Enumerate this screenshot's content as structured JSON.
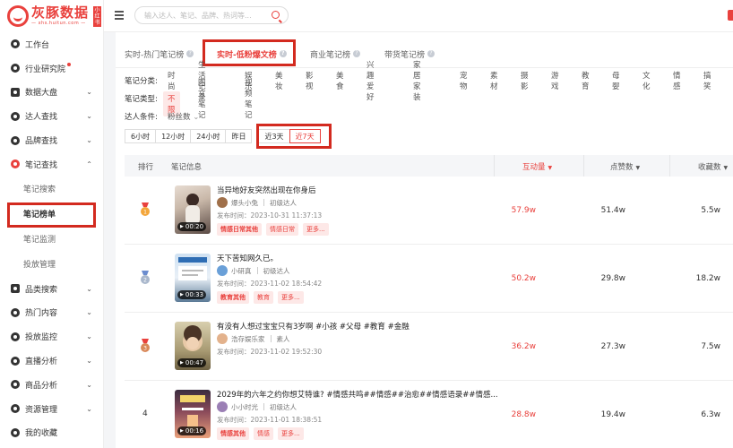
{
  "app": {
    "logo_name": "灰豚数据",
    "logo_sub": "— xhs.huitun.com —",
    "logo_badge": "小红书",
    "brand_color": "#e9413d"
  },
  "search": {
    "placeholder": "输入达人、笔记、品牌、热词等...",
    "value": ""
  },
  "sidebar": {
    "items": [
      {
        "label": "工作台",
        "icon": "home-icon"
      },
      {
        "label": "行业研究院",
        "icon": "research-icon"
      },
      {
        "label": "数据大盘",
        "icon": "dashboard-icon"
      },
      {
        "label": "达人查找",
        "icon": "search-user-icon"
      },
      {
        "label": "品牌查找",
        "icon": "brand-icon"
      },
      {
        "label": "笔记查找",
        "icon": "note-icon"
      },
      {
        "label": "品类搜索",
        "icon": "category-icon"
      },
      {
        "label": "热门内容",
        "icon": "fire-icon"
      },
      {
        "label": "投放监控",
        "icon": "monitor-icon"
      },
      {
        "label": "直播分析",
        "icon": "live-icon"
      },
      {
        "label": "商品分析",
        "icon": "goods-icon"
      },
      {
        "label": "资源管理",
        "icon": "resource-icon"
      },
      {
        "label": "我的收藏",
        "icon": "star-icon"
      }
    ],
    "subitems": [
      {
        "label": "笔记搜索"
      },
      {
        "label": "笔记榜单"
      },
      {
        "label": "笔记监测"
      },
      {
        "label": "投放管理"
      }
    ]
  },
  "tabs": [
    {
      "label": "实时-热门笔记榜"
    },
    {
      "label": "实时-低粉爆文榜"
    },
    {
      "label": "商业笔记榜"
    },
    {
      "label": "带货笔记榜"
    }
  ],
  "filters": {
    "category_label": "笔记分类:",
    "categories": [
      "时尚",
      "生活记录",
      "娱乐",
      "美妆",
      "影视",
      "美食",
      "兴趣爱好",
      "家居家装",
      "宠物",
      "素材",
      "摄影",
      "游戏",
      "教育",
      "母婴",
      "文化",
      "情感",
      "搞笑"
    ],
    "type_label": "笔记类型:",
    "types": [
      "不限",
      "图文笔记",
      "视频笔记"
    ],
    "creator_label": "达人条件:",
    "creator_value": "粉丝数"
  },
  "time_ranges": [
    "6小时",
    "12小时",
    "24小时",
    "昨日",
    "近3天",
    "近7天"
  ],
  "table": {
    "headers": {
      "rank": "排行",
      "info": "笔记信息",
      "interaction": "互动量",
      "likes": "点赞数",
      "favorites": "收藏数"
    },
    "rows": [
      {
        "rank": "",
        "title": "当异地好友突然出现在你身后",
        "author": "爆头小兔",
        "level": "初级达人",
        "pubtime": "发布时间：2023-10-31 11:37:13",
        "duration": "00:20",
        "tags": [
          "情感日常其他",
          "情感日常",
          "更多..."
        ],
        "interaction": "57.9w",
        "likes": "51.4w",
        "favorites": "5.5w"
      },
      {
        "rank": "",
        "title": "天下苦知网久已。",
        "author": "小研真",
        "level": "初级达人",
        "pubtime": "发布时间：2023-11-02 18:54:42",
        "duration": "00:33",
        "tags": [
          "教育其他",
          "教育",
          "更多..."
        ],
        "interaction": "50.2w",
        "likes": "29.8w",
        "favorites": "18.2w"
      },
      {
        "rank": "",
        "title": "有没有人想过宝宝只有3岁啊 #小孩 #父母 #教育 #金融",
        "author": "浩存娱乐家",
        "level": "素人",
        "pubtime": "发布时间：2023-11-02 19:52:30",
        "duration": "00:47",
        "tags": [],
        "interaction": "36.2w",
        "likes": "27.3w",
        "favorites": "7.5w"
      },
      {
        "rank": "4",
        "title": "2029年的六年之约你想艾特谁? #情感共鸣##情感##治愈##情感语录##情感...",
        "author": "小小时光",
        "level": "初级达人",
        "pubtime": "发布时间：2023-11-01 18:38:51",
        "duration": "00:16",
        "tags": [
          "情感其他",
          "情感",
          "更多..."
        ],
        "interaction": "28.8w",
        "likes": "19.4w",
        "favorites": "6.3w"
      }
    ]
  }
}
